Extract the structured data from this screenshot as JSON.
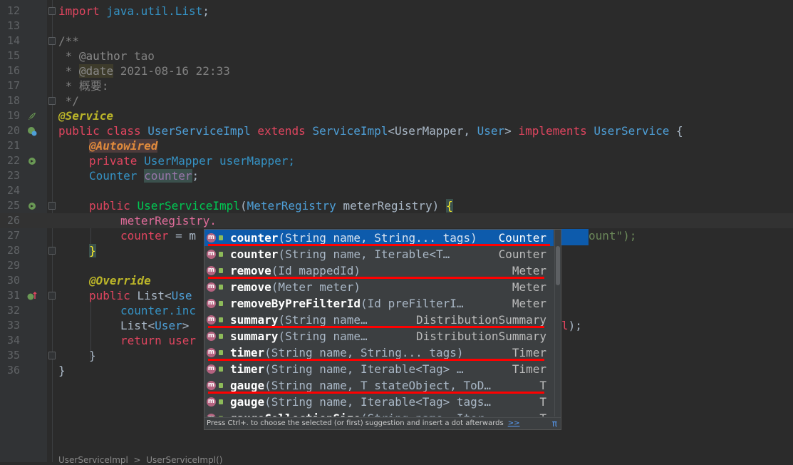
{
  "editor": {
    "lines": [
      {
        "num": "12"
      },
      {
        "num": "13"
      },
      {
        "num": "14"
      },
      {
        "num": "15"
      },
      {
        "num": "16"
      },
      {
        "num": "17"
      },
      {
        "num": "18"
      },
      {
        "num": "19"
      },
      {
        "num": "20"
      },
      {
        "num": "21"
      },
      {
        "num": "22"
      },
      {
        "num": "23"
      },
      {
        "num": "24"
      },
      {
        "num": "25"
      },
      {
        "num": "26"
      },
      {
        "num": "27"
      },
      {
        "num": "28"
      },
      {
        "num": "29"
      },
      {
        "num": "30"
      },
      {
        "num": "31"
      },
      {
        "num": "32"
      },
      {
        "num": "33"
      },
      {
        "num": "34"
      },
      {
        "num": "35"
      },
      {
        "num": "36"
      }
    ],
    "code": {
      "l12_kw": "import",
      "l12_rest": " java.util.",
      "l12_cls": "List",
      "l12_semi": ";",
      "l14": "/**",
      "l15_star": " * ",
      "l15_tag": "@author",
      "l15_val": " tao",
      "l16_star": " * ",
      "l16_tag": "@date",
      "l16_val": " 2021-08-16 22:33",
      "l17": " * 概要:",
      "l18": " */",
      "l19": "@Service",
      "l20_kw1": "public class ",
      "l20_cls": "UserServiceImpl",
      "l20_kw2": " extends ",
      "l20_cls2": "ServiceImpl",
      "l20_mid": "<UserMapper, ",
      "l20_user": "User",
      "l20_gt": "> ",
      "l20_kw3": "implements ",
      "l20_cls3": "UserService",
      "l20_brace": " {",
      "l21": "@Autowired",
      "l22_kw": "private ",
      "l22_rest": "UserMapper userMapper;",
      "l23_type": "Counter ",
      "l23_field": "counter",
      "l23_semi": ";",
      "l25_kw": "public ",
      "l25_fn": "UserServiceImpl",
      "l25_lp": "(",
      "l25_type": "MeterRegistry",
      "l25_param": " meterRegistry) ",
      "l25_brace": "{",
      "l26": "meterRegistry.",
      "l27_field": "counter",
      "l27_eq": " = m",
      "l27_tail": "ount\");",
      "l28": "}",
      "l30": "@Override",
      "l31_kw": "public ",
      "l31_rest": "List<",
      "l31_user": "Use",
      "l32": "counter.inc",
      "l33_a": "List<",
      "l33_b": "User",
      "l33_c": ">",
      "l33_tail_red": "l",
      "l33_tail": ");",
      "l34_kw": "return ",
      "l34_rest": "user",
      "l35": "}",
      "l36": "}"
    }
  },
  "completion": {
    "items": [
      {
        "name": "counter",
        "params": "(String name, String... tags)",
        "type": "Counter",
        "selected": true,
        "underlined": true
      },
      {
        "name": "counter",
        "params": "(String name, Iterable<T…",
        "type": "Counter",
        "selected": false,
        "underlined": false
      },
      {
        "name": "remove",
        "params": "(Id mappedId)",
        "type": "Meter",
        "selected": false,
        "underlined": true
      },
      {
        "name": "remove",
        "params": "(Meter meter)",
        "type": "Meter",
        "selected": false,
        "underlined": false
      },
      {
        "name": "removeByPreFilterId",
        "params": "(Id preFilterI…",
        "type": "Meter",
        "selected": false,
        "underlined": false
      },
      {
        "name": "summary",
        "params": "(String name…",
        "type": "DistributionSummary",
        "selected": false,
        "underlined": true
      },
      {
        "name": "summary",
        "params": "(String name…",
        "type": "DistributionSummary",
        "selected": false,
        "underlined": false
      },
      {
        "name": "timer",
        "params": "(String name, String... tags)",
        "type": "Timer",
        "selected": false,
        "underlined": true
      },
      {
        "name": "timer",
        "params": "(String name, Iterable<Tag> …",
        "type": "Timer",
        "selected": false,
        "underlined": false
      },
      {
        "name": "gauge",
        "params": "(String name, T stateObject, ToD…",
        "type": "T",
        "selected": false,
        "underlined": true
      },
      {
        "name": "gauge",
        "params": "(String name, Iterable<Tag> tags…",
        "type": "T",
        "selected": false,
        "underlined": false
      },
      {
        "name": "gaugeCollectionSize",
        "params": "(String name, Iter…",
        "type": "T",
        "selected": false,
        "underlined": false
      }
    ],
    "footer_hint": "Press Ctrl+. to choose the selected (or first) suggestion and insert a dot afterwards",
    "footer_more": ">>",
    "footer_pi": "π"
  },
  "breadcrumb": "UserServiceImpl  >  UserServiceImpl()"
}
